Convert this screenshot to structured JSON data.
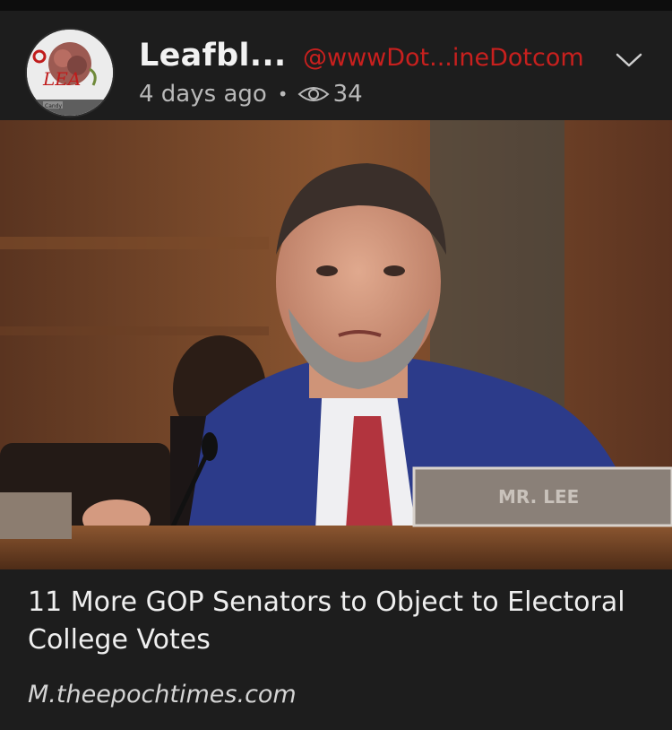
{
  "post": {
    "author": "Leafbl...",
    "handle": "@wwwDot...ineDotcom",
    "time_ago": "4 days ago",
    "separator": "•",
    "view_count": "34",
    "avatar_text": "LEA",
    "avatar_caption": "Candy",
    "nameplate_text": "MR. LEE"
  },
  "article": {
    "headline": "11 More GOP Senators to Object to Electoral College Votes",
    "source": "M.theepochtimes.com"
  },
  "colors": {
    "handle": "#c8201e",
    "background": "#1d1d1d"
  },
  "icons": {
    "views": "eye-icon",
    "menu": "chevron-down-icon"
  }
}
